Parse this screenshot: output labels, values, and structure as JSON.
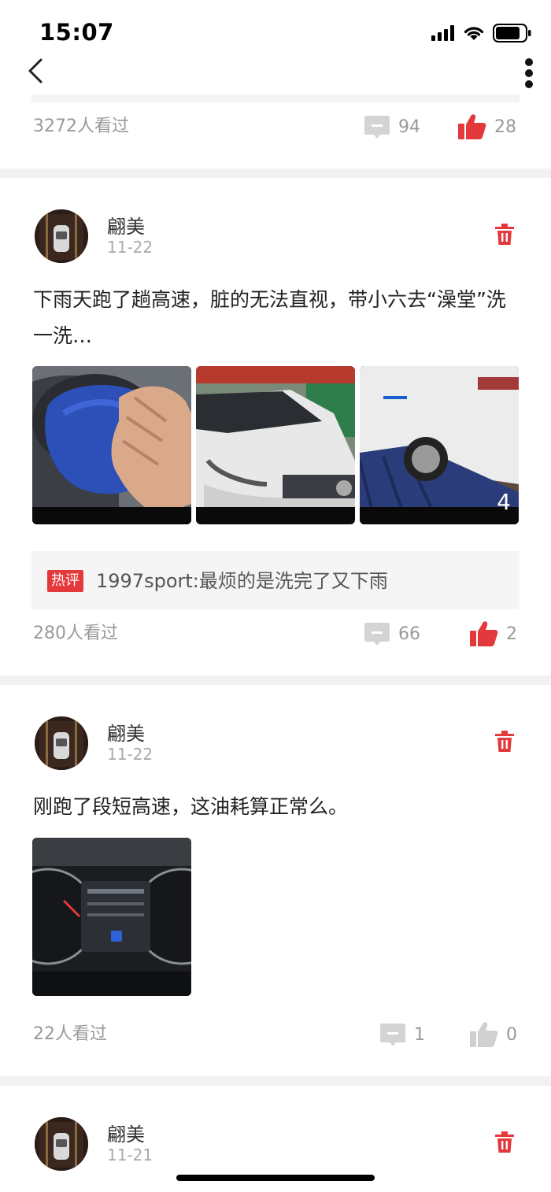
{
  "status_bar": {
    "time": "15:07"
  },
  "prev_post": {
    "views": "3272人看过",
    "comments": "94",
    "likes": "28"
  },
  "posts": [
    {
      "author": "翩美",
      "date": "11-22",
      "text": "下雨天跑了趟高速，脏的无法直视，带小六去“澡堂”洗一洗…",
      "image_count": "4",
      "hot_comment": {
        "tag": "热评",
        "text": "1997sport:最烦的是洗完了又下雨"
      },
      "views": "280人看过",
      "comments": "66",
      "likes": "2"
    },
    {
      "author": "翩美",
      "date": "11-22",
      "text": "刚跑了段短高速，这油耗算正常么。",
      "views": "22人看过",
      "comments": "1",
      "likes": "0"
    },
    {
      "author": "翩美",
      "date": "11-21"
    }
  ],
  "colors": {
    "accent_red": "#e4393c",
    "muted_gray": "#999999",
    "divider": "#f2f2f2"
  }
}
